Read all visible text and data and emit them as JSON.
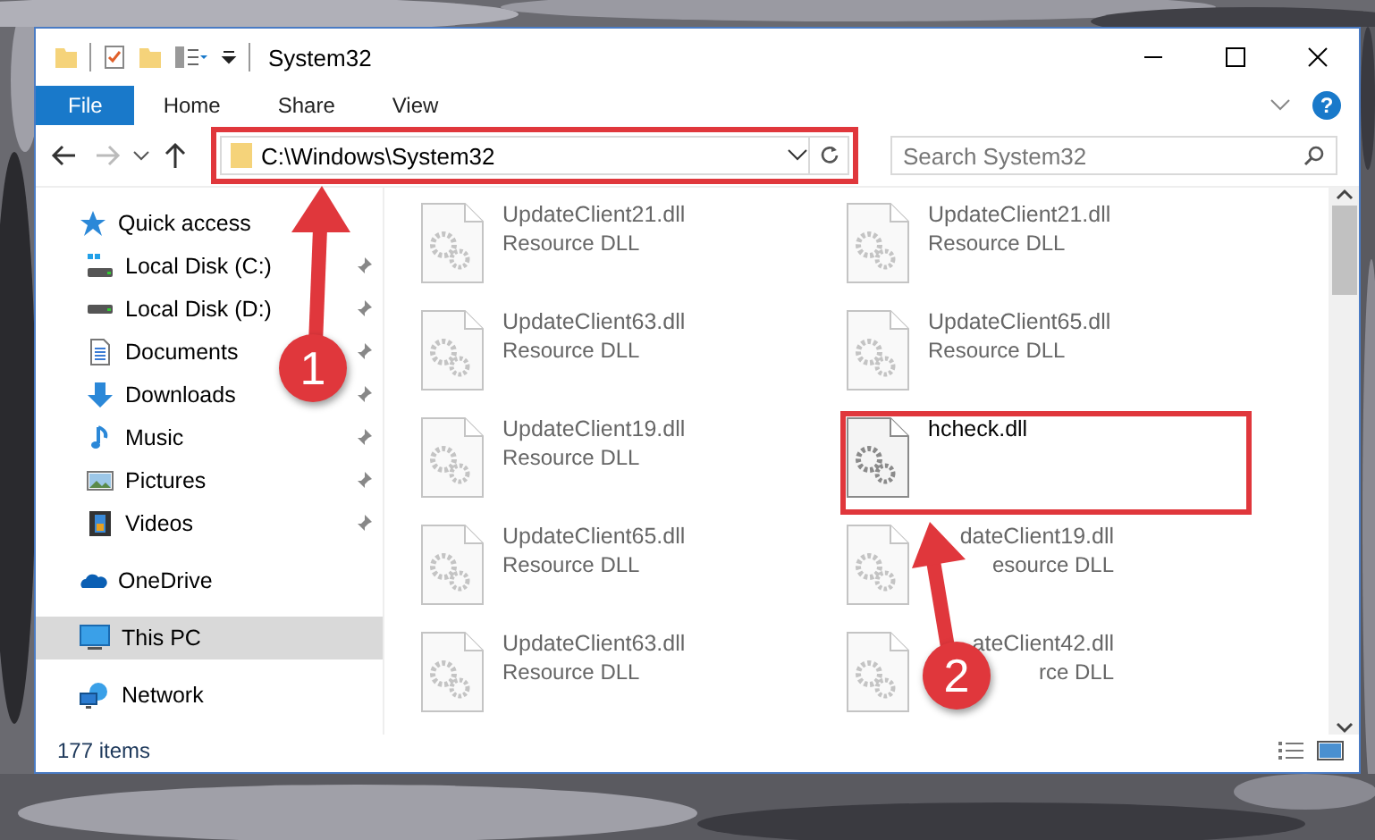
{
  "window": {
    "title": "System32"
  },
  "ribbon_tabs": [
    {
      "label": "File",
      "selected": true
    },
    {
      "label": "Home",
      "selected": false
    },
    {
      "label": "Share",
      "selected": false
    },
    {
      "label": "View",
      "selected": false
    }
  ],
  "help": "?",
  "address_bar": {
    "path": "C:\\Windows\\System32",
    "highlighted": true
  },
  "search": {
    "placeholder": "Search System32"
  },
  "nav_pane": [
    {
      "label": "Quick access",
      "kind": "quick",
      "selected": false,
      "children": [
        {
          "label": "Local Disk (C:)",
          "kind": "drive-c",
          "pinned": true,
          "selected": false
        },
        {
          "label": "Local Disk (D:)",
          "kind": "drive",
          "pinned": true,
          "selected": false
        },
        {
          "label": "Documents",
          "kind": "documents",
          "pinned": true,
          "selected": false
        },
        {
          "label": "Downloads",
          "kind": "downloads",
          "pinned": true,
          "selected": false
        },
        {
          "label": "Music",
          "kind": "music",
          "pinned": true,
          "selected": false
        },
        {
          "label": "Pictures",
          "kind": "pictures",
          "pinned": true,
          "selected": false
        },
        {
          "label": "Videos",
          "kind": "videos",
          "pinned": true,
          "selected": false
        }
      ]
    },
    {
      "label": "OneDrive",
      "kind": "cloud",
      "selected": false
    },
    {
      "label": "This PC",
      "kind": "pc",
      "selected": true
    },
    {
      "label": "Network",
      "kind": "network",
      "selected": false
    }
  ],
  "files": [
    {
      "name": "UpdateClient21.dll",
      "type": "Resource DLL",
      "dimmed": true,
      "highlighted": false,
      "covered": false
    },
    {
      "name": "UpdateClient21.dll",
      "type": "Resource DLL",
      "dimmed": true,
      "highlighted": false,
      "covered": false
    },
    {
      "name": "UpdateClient63.dll",
      "type": "Resource DLL",
      "dimmed": true,
      "highlighted": false,
      "covered": false
    },
    {
      "name": "UpdateClient65.dll",
      "type": "Resource DLL",
      "dimmed": true,
      "highlighted": false,
      "covered": false
    },
    {
      "name": "UpdateClient19.dll",
      "type": "Resource DLL",
      "dimmed": true,
      "highlighted": false,
      "covered": false
    },
    {
      "name": "hcheck.dll",
      "dimmed": false,
      "highlighted": true,
      "covered": false
    },
    {
      "name": "UpdateClient65.dll",
      "type": "Resource DLL",
      "dimmed": true,
      "highlighted": false,
      "covered": false
    },
    {
      "name": "dateClient19.dll",
      "type": "esource DLL",
      "dimmed": true,
      "highlighted": false,
      "covered": true
    },
    {
      "name": "UpdateClient63.dll",
      "type": "Resource DLL",
      "dimmed": true,
      "highlighted": false,
      "covered": false
    },
    {
      "name": "ateClient42.dll",
      "type": "rce DLL",
      "dimmed": true,
      "highlighted": false,
      "covered": true
    }
  ],
  "status_bar": {
    "item_count": "177 items"
  },
  "annotations": [
    {
      "number": "1"
    },
    {
      "number": "2"
    }
  ]
}
